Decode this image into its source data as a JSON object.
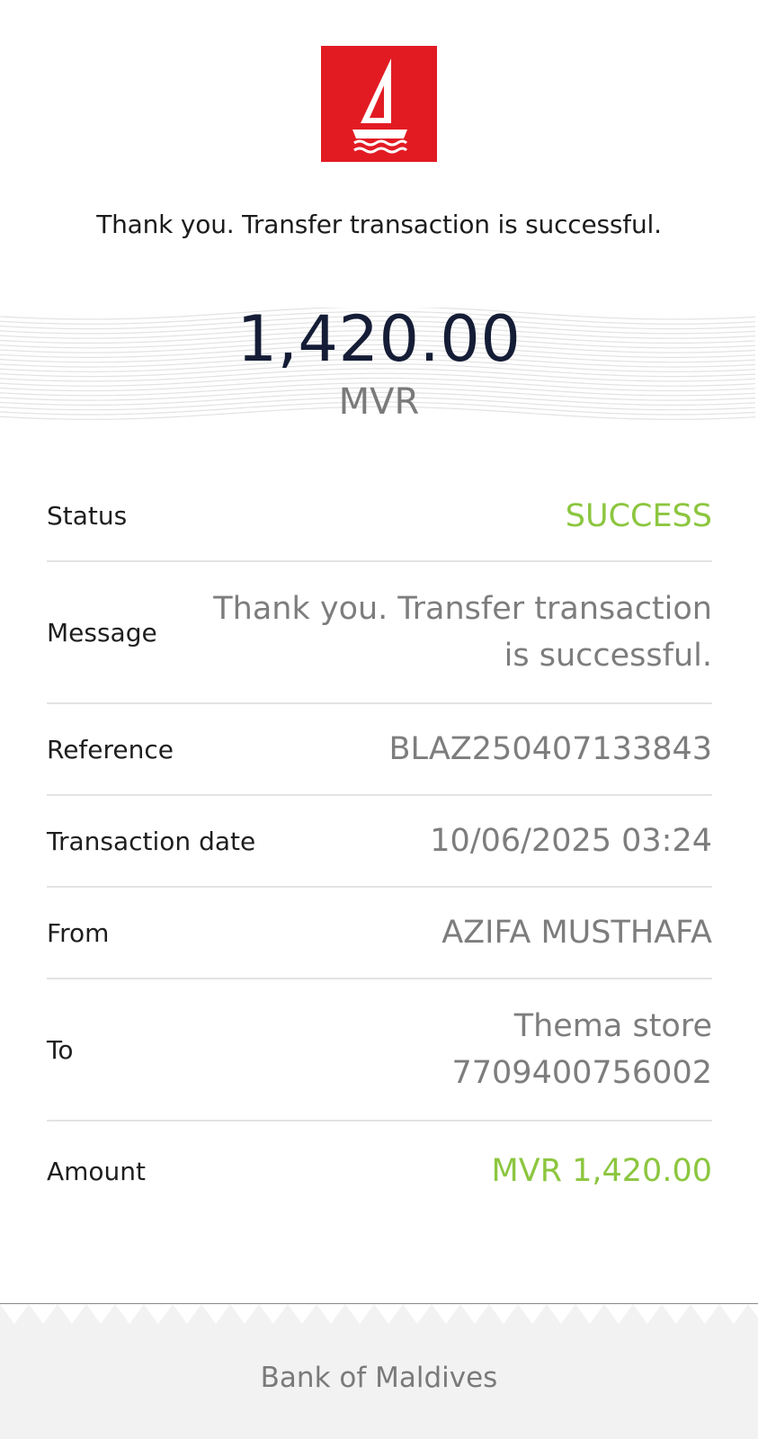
{
  "brand": {
    "logo_icon": "sailboat-icon",
    "brand_color": "#e21b23"
  },
  "headline": "Thank you. Transfer transaction is successful.",
  "amount": {
    "value": "1,420.00",
    "currency": "MVR"
  },
  "details": {
    "status": {
      "label": "Status",
      "value": "SUCCESS"
    },
    "message": {
      "label": "Message",
      "value_line1": "Thank you. Transfer transaction",
      "value_line2": "is successful."
    },
    "reference": {
      "label": "Reference",
      "value": "BLAZ250407133843"
    },
    "transaction_date": {
      "label": "Transaction date",
      "value": "10/06/2025 03:24"
    },
    "from": {
      "label": "From",
      "value": "AZIFA MUSTHAFA"
    },
    "to": {
      "label": "To",
      "value_line1": "Thema store",
      "value_line2": "7709400756002"
    },
    "amount": {
      "label": "Amount",
      "value": "MVR 1,420.00"
    }
  },
  "footer": {
    "bank_name": "Bank of Maldives"
  },
  "colors": {
    "success": "#8cc63f",
    "amount_text": "#151d36",
    "muted_text": "#7d7d7d"
  }
}
